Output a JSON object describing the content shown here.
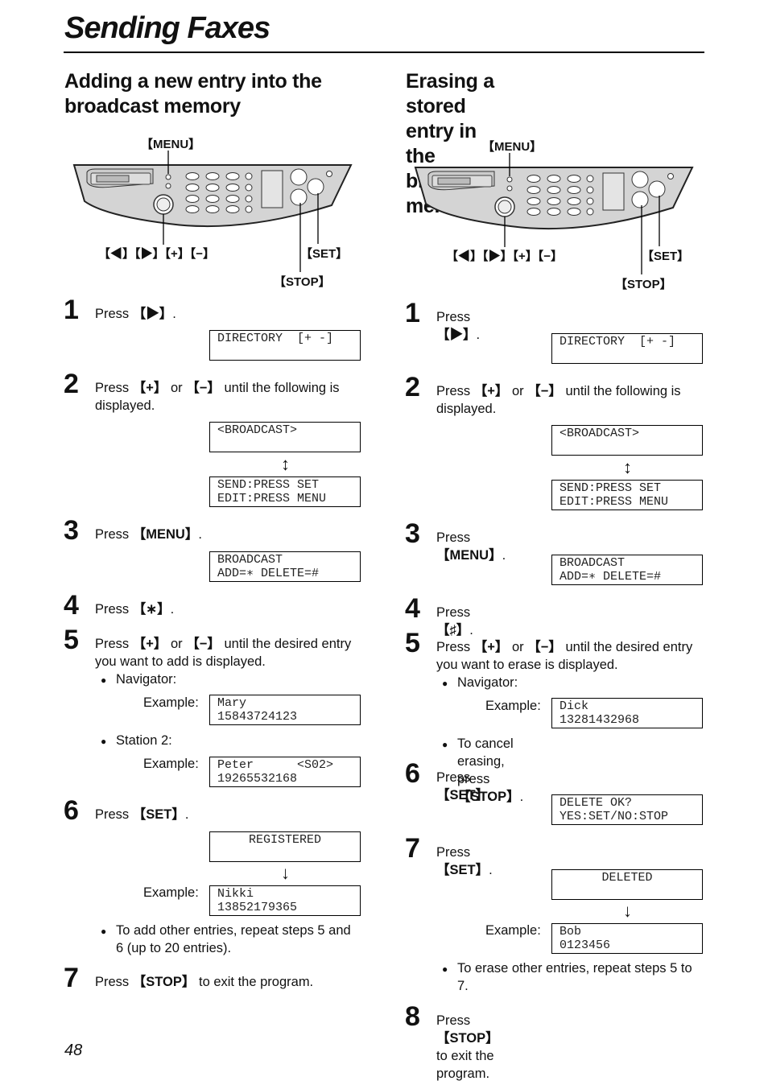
{
  "page": {
    "title": "Sending Faxes",
    "page_number": "48"
  },
  "left": {
    "heading": [
      "Adding a new entry into the",
      "broadcast memory"
    ],
    "diagram": {
      "menu": "【MENU】",
      "nav": "【◀】【▶】【+】【−】",
      "set": "【SET】",
      "stop": "【STOP】"
    },
    "steps": {
      "s1": {
        "num": "1",
        "pre": "Press ",
        "key": "【▶】",
        "post": ".",
        "lcd": "DIRECTORY  [+ -]\n"
      },
      "s2": {
        "num": "2",
        "pre": "Press ",
        "key1": "【+】",
        "mid": " or ",
        "key2": "【−】",
        "post": " until the following is",
        "line2": "displayed.",
        "lcd1": "<BROADCAST>\n",
        "lcd2": "SEND:PRESS SET\nEDIT:PRESS MENU"
      },
      "s3": {
        "num": "3",
        "pre": "Press ",
        "key": "【MENU】",
        "post": ".",
        "lcd": "BROADCAST\nADD=∗ DELETE=#"
      },
      "s4": {
        "num": "4",
        "pre": "Press ",
        "key": "【∗】",
        "post": "."
      },
      "s5": {
        "num": "5",
        "pre": "Press ",
        "key1": "【+】",
        "mid": " or ",
        "key2": "【−】",
        "post": " until the desired entry",
        "line2": "you want to add is displayed.",
        "bullet1": "Navigator:",
        "example_label": "Example:",
        "lcd1": "Mary\n15843724123",
        "bullet2": "Station 2:",
        "lcd2": "Peter      <S02>\n19265532168"
      },
      "s6": {
        "num": "6",
        "pre": "Press ",
        "key": "【SET】",
        "post": ".",
        "lcd1": "REGISTERED\n",
        "example_label": "Example:",
        "lcd2": "Nikki\n13852179365",
        "bullet": "To add other entries, repeat steps 5 and",
        "bullet_line2": "6 (up to 20 entries)."
      },
      "s7": {
        "num": "7",
        "pre": "Press ",
        "key": "【STOP】",
        "post": " to exit the program."
      }
    }
  },
  "right": {
    "heading": [
      "Erasing a stored entry in the",
      "broadcast memory"
    ],
    "diagram": {
      "menu": "【MENU】",
      "nav": "【◀】【▶】【+】【−】",
      "set": "【SET】",
      "stop": "【STOP】"
    },
    "steps": {
      "s1": {
        "num": "1",
        "pre": "Press ",
        "key": "【▶】",
        "post": ".",
        "lcd": "DIRECTORY  [+ -]\n"
      },
      "s2": {
        "num": "2",
        "pre": "Press ",
        "key1": "【+】",
        "mid": " or ",
        "key2": "【−】",
        "post": " until the following is",
        "line2": "displayed.",
        "lcd1": "<BROADCAST>\n",
        "lcd2": "SEND:PRESS SET\nEDIT:PRESS MENU"
      },
      "s3": {
        "num": "3",
        "pre": "Press ",
        "key": "【MENU】",
        "post": ".",
        "lcd": "BROADCAST\nADD=∗ DELETE=#"
      },
      "s4": {
        "num": "4",
        "pre": "Press ",
        "key": "【♯】",
        "post": "."
      },
      "s5": {
        "num": "5",
        "pre": "Press ",
        "key1": "【+】",
        "mid": " or ",
        "key2": "【−】",
        "post": " until the desired entry",
        "line2": "you want to erase is displayed.",
        "bullet1": "Navigator:",
        "example_label": "Example:",
        "lcd1": "Dick\n13281432968",
        "bullet2_pre": "To cancel erasing, press ",
        "bullet2_key": "【STOP】",
        "bullet2_post": "."
      },
      "s6": {
        "num": "6",
        "pre": "Press ",
        "key": "【SET】",
        "post": ".",
        "lcd": "DELETE OK?\nYES:SET/NO:STOP"
      },
      "s7": {
        "num": "7",
        "pre": "Press ",
        "key": "【SET】",
        "post": ".",
        "lcd1": "DELETED\n",
        "example_label": "Example:",
        "lcd2": "Bob\n0123456",
        "bullet": "To erase other entries, repeat steps 5 to",
        "bullet_line2": "7."
      },
      "s8": {
        "num": "8",
        "pre": "Press ",
        "key": "【STOP】",
        "post": " to exit the program."
      }
    }
  }
}
